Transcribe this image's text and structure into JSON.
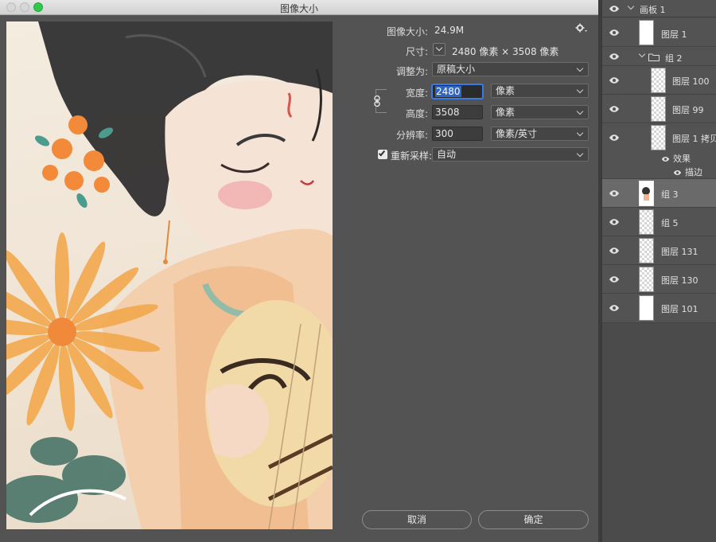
{
  "window": {
    "title": "图像大小"
  },
  "form": {
    "image_size_label": "图像大小:",
    "image_size_value": "24.9M",
    "dimensions_label": "尺寸:",
    "dimensions_value": "2480 像素  ×  3508 像素",
    "fit_to_label": "调整为:",
    "fit_to_value": "原稿大小",
    "width_label": "宽度:",
    "width_value": "2480",
    "width_unit": "像素",
    "height_label": "高度:",
    "height_value": "3508",
    "height_unit": "像素",
    "resolution_label": "分辨率:",
    "resolution_value": "300",
    "resolution_unit": "像素/英寸",
    "resample_label": "重新采样:",
    "resample_checked": true,
    "resample_value": "自动"
  },
  "buttons": {
    "cancel": "取消",
    "ok": "确定"
  },
  "layers": {
    "artboard": "画板 1",
    "items": [
      {
        "name": "图层 1"
      },
      {
        "name": "组 2"
      },
      {
        "name": "图层 100"
      },
      {
        "name": "图层 99"
      },
      {
        "name": "图层 1 拷贝"
      },
      {
        "name": "效果"
      },
      {
        "name": "描边"
      },
      {
        "name": "组 3"
      },
      {
        "name": "组 5"
      },
      {
        "name": "图层 131"
      },
      {
        "name": "图层 130"
      },
      {
        "name": "图层 101"
      }
    ]
  },
  "colors": {
    "panel_bg": "#535353",
    "accent_blue": "#2d66c4",
    "close_green": "#2ec84a"
  }
}
